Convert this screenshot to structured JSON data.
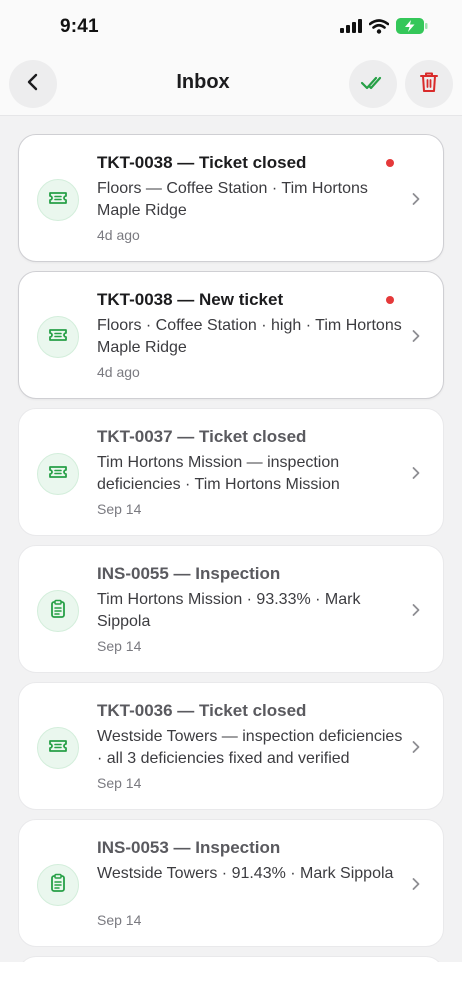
{
  "status_bar": {
    "time": "9:41",
    "icons": [
      "signal-icon",
      "wifi-icon",
      "battery-charging-icon"
    ],
    "battery_color": "#34c759"
  },
  "nav": {
    "title": "Inbox",
    "back_icon": "chevron-left-icon",
    "mark_read_icon": "double-check-icon",
    "delete_icon": "trash-icon",
    "accent_green": "#27a047",
    "accent_red": "#d92b2b"
  },
  "notifications": [
    {
      "title": "TKT-0038 — Ticket closed",
      "body": "Floors — Coffee Station · Tim Hortons Maple Ridge",
      "time": "4d ago",
      "unread": true,
      "icon": "ticket-icon"
    },
    {
      "title": "TKT-0038 — New ticket",
      "body": "Floors · Coffee Station · high · Tim Hortons Maple Ridge",
      "time": "4d ago",
      "unread": true,
      "icon": "ticket-icon"
    },
    {
      "title": "TKT-0037 — Ticket closed",
      "body": "Tim Hortons Mission — inspection deficiencies · Tim Hortons Mission",
      "time": "Sep 14",
      "unread": false,
      "icon": "ticket-icon"
    },
    {
      "title": "INS-0055 — Inspection",
      "body": "Tim Hortons Mission · 93.33% · Mark Sippola",
      "time": "Sep 14",
      "unread": false,
      "icon": "clipboard-icon"
    },
    {
      "title": "TKT-0036 — Ticket closed",
      "body": "Westside Towers — inspection deficiencies · all 3 deficiencies fixed and verified",
      "time": "Sep 14",
      "unread": false,
      "icon": "ticket-icon"
    },
    {
      "title": "INS-0053 — Inspection",
      "body": "Westside Towers · 91.43% · Mark Sippola",
      "time": "Sep 14",
      "unread": false,
      "icon": "clipboard-icon"
    }
  ]
}
